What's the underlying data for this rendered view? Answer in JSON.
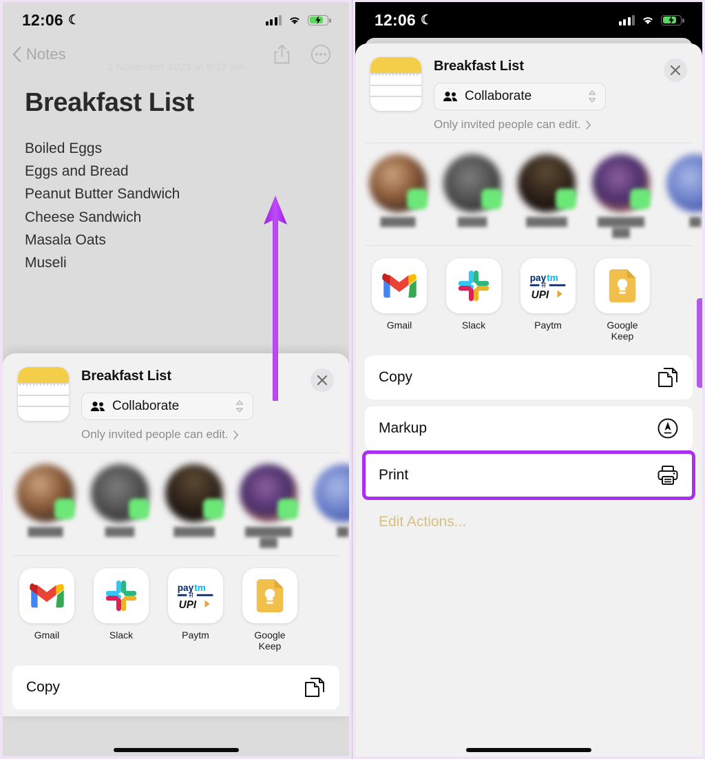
{
  "status_bar": {
    "time": "12:06",
    "moon_glyph": "☾",
    "signal": "cellular-signal",
    "wifi": "wifi",
    "battery": "battery-charging"
  },
  "left_panel": {
    "nav": {
      "back_label": "Notes",
      "share_icon": "share-icon",
      "more_icon": "more-ellipsis-icon"
    },
    "note": {
      "date": "2 November 2023 at 9:32 am",
      "title": "Breakfast List",
      "items": [
        "Boiled Eggs",
        "Eggs and Bread",
        "Peanut Butter Sandwich",
        "Cheese Sandwich",
        "Masala Oats",
        "Museli"
      ]
    },
    "annotation": {
      "type": "arrow-up",
      "color": "#b23ef0"
    }
  },
  "share_sheet": {
    "doc_icon": "notes-document-icon",
    "title": "Breakfast List",
    "collaborate": {
      "label": "Collaborate",
      "people_icon": "people-icon",
      "stepper_icon": "up-down-chevron-icon"
    },
    "permission": {
      "text": "Only invited people can edit.",
      "chevron": "chevron-right-icon"
    },
    "close_icon": "close-x-icon",
    "contacts": [
      {
        "name": "██████",
        "badge": "imessage-badge"
      },
      {
        "name": "█████",
        "badge": "imessage-badge"
      },
      {
        "name": "███████",
        "badge": "imessage-badge"
      },
      {
        "name": "████████ ███",
        "badge": "imessage-badge"
      },
      {
        "name": "██",
        "badge": "imessage-badge"
      }
    ],
    "apps": [
      {
        "label": "Gmail",
        "icon": "gmail-icon"
      },
      {
        "label": "Slack",
        "icon": "slack-icon"
      },
      {
        "label": "Paytm",
        "icon": "paytm-upi-icon"
      },
      {
        "label": "Google Keep",
        "icon": "google-keep-icon"
      }
    ],
    "actions": [
      {
        "label": "Copy",
        "icon": "copy-icon",
        "highlighted": false
      },
      {
        "label": "Markup",
        "icon": "markup-icon",
        "highlighted": false
      },
      {
        "label": "Print",
        "icon": "print-icon",
        "highlighted": true
      }
    ],
    "edit_actions_label": "Edit Actions...",
    "highlight_color": "#aa2ff0"
  }
}
